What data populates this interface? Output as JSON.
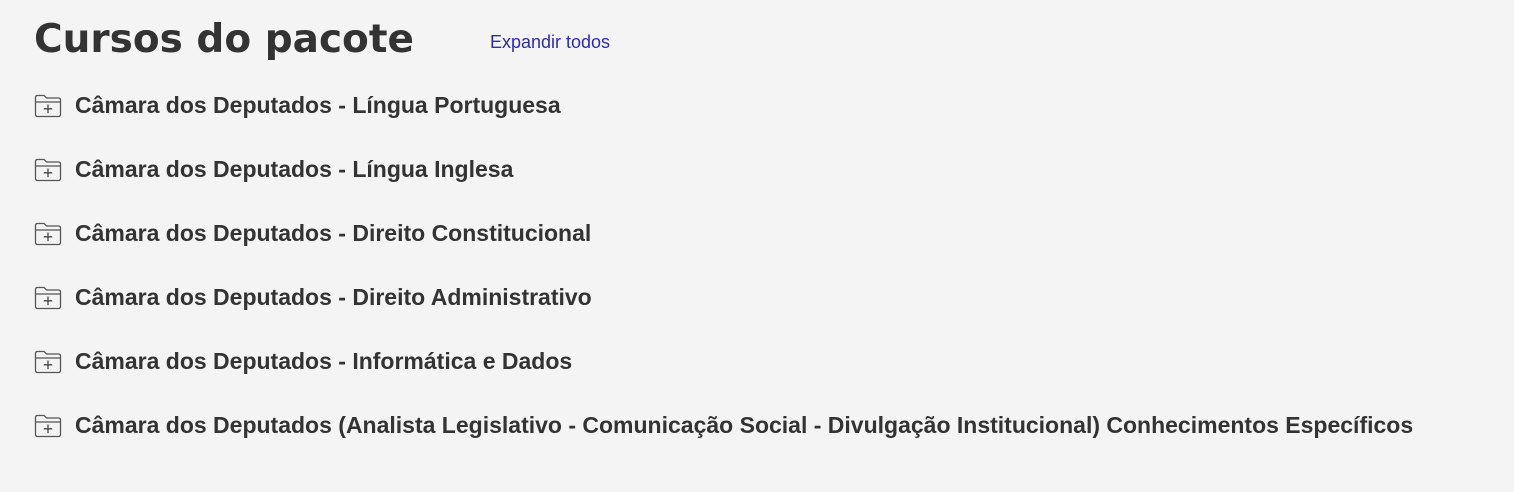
{
  "header": {
    "title": "Cursos do pacote",
    "expand_all_label": "Expandir todos"
  },
  "colors": {
    "background": "#f4f4f4",
    "text": "#333333",
    "link": "#2b2bb0"
  },
  "courses": [
    {
      "label": "Câmara dos Deputados - Língua Portuguesa",
      "icon": "folder-plus-icon"
    },
    {
      "label": "Câmara dos Deputados - Língua Inglesa",
      "icon": "folder-plus-icon"
    },
    {
      "label": "Câmara dos Deputados - Direito Constitucional",
      "icon": "folder-plus-icon"
    },
    {
      "label": "Câmara dos Deputados - Direito Administrativo",
      "icon": "folder-plus-icon"
    },
    {
      "label": "Câmara dos Deputados - Informática e Dados",
      "icon": "folder-plus-icon"
    },
    {
      "label": "Câmara dos Deputados (Analista Legislativo - Comunicação Social - Divulgação Institucional) Conhecimentos Específicos",
      "icon": "folder-plus-icon"
    }
  ]
}
